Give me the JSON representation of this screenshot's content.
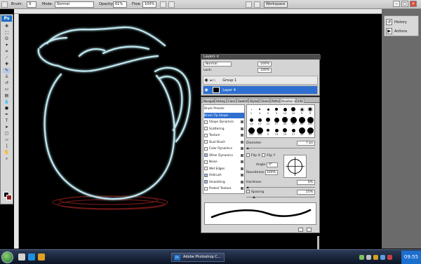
{
  "options_bar": {
    "tool_label": "Brush:",
    "brush_size": "9",
    "mode_label": "Mode:",
    "mode_value": "Normal",
    "opacity_label": "Opacity:",
    "opacity_value": "61%",
    "flow_label": "Flow:",
    "flow_value": "100%",
    "workspace_label": "Workspace"
  },
  "toolbox": {
    "logo": "Ps"
  },
  "dock": {
    "items": [
      {
        "label": "History",
        "icon": "history-icon"
      },
      {
        "label": "Actions",
        "icon": "actions-icon"
      }
    ]
  },
  "layers_panel": {
    "tab": "Layers ×",
    "blend_mode": "Normal",
    "opacity_value": "100%",
    "fill_value": "100%",
    "lock_label": "Lock:",
    "layers": [
      {
        "name": "Group 1",
        "selected": false
      },
      {
        "name": "Layer 4",
        "selected": true
      }
    ]
  },
  "brushes_panel": {
    "tabs": [
      "Navigat",
      "Histog",
      "Color",
      "Swatch",
      "Styles",
      "Chann",
      "Paths",
      "Brushes ×",
      "Info"
    ],
    "active_tab": "Brushes ×",
    "list": [
      {
        "label": "Brush Presets",
        "check": false,
        "lock": false,
        "selected": false
      },
      {
        "label": "Brush Tip Shape",
        "check": false,
        "lock": false,
        "selected": true
      },
      {
        "label": "Shape Dynamics",
        "check": false,
        "lock": true,
        "selected": false
      },
      {
        "label": "Scattering",
        "check": false,
        "lock": true,
        "selected": false
      },
      {
        "label": "Texture",
        "check": false,
        "lock": true,
        "selected": false
      },
      {
        "label": "Dual Brush",
        "check": false,
        "lock": true,
        "selected": false
      },
      {
        "label": "Color Dynamics",
        "check": false,
        "lock": true,
        "selected": false
      },
      {
        "label": "Other Dynamics",
        "check": true,
        "lock": true,
        "selected": false
      },
      {
        "label": "Noise",
        "check": false,
        "lock": true,
        "selected": false
      },
      {
        "label": "Wet Edges",
        "check": false,
        "lock": true,
        "selected": false
      },
      {
        "label": "Airbrush",
        "check": true,
        "lock": true,
        "selected": false
      },
      {
        "label": "Smoothing",
        "check": true,
        "lock": true,
        "selected": false
      },
      {
        "label": "Protect Texture",
        "check": false,
        "lock": true,
        "selected": false
      }
    ],
    "tip_sizes": [
      "1",
      "3",
      "5",
      "9",
      "13",
      "19",
      "5",
      "9",
      "13",
      "17",
      "21",
      "27",
      "35",
      "45",
      "65",
      "100",
      "200",
      "300",
      "9",
      "13",
      "19",
      "17",
      "45",
      "65"
    ],
    "diameter_label": "Diameter",
    "diameter_value": "7 px",
    "flip_x": "Flip X",
    "flip_y": "Flip Y",
    "angle_label": "Angle:",
    "angle_value": "0°",
    "roundness_label": "Roundness:",
    "roundness_value": "100%",
    "hardness_label": "Hardness",
    "hardness_value": "0%",
    "spacing_label": "Spacing",
    "spacing_value": "25%"
  },
  "canvas": {
    "stroke_color": "#bfe8f0",
    "shadow_color": "#7a1a1a"
  },
  "taskbar": {
    "active_app": "Adobe Photoshop C...",
    "clock": "09:55"
  }
}
